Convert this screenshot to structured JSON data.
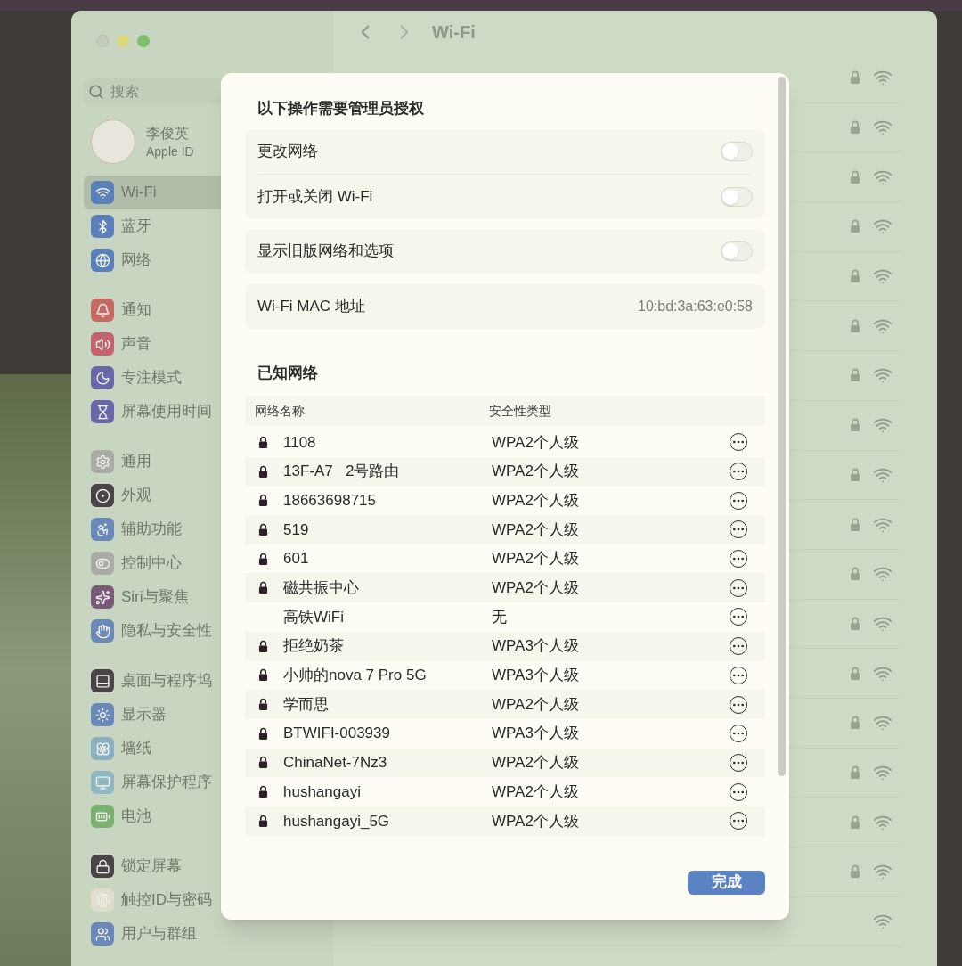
{
  "window": {
    "title": "Wi-Fi"
  },
  "sidebar": {
    "search": {
      "placeholder": "搜索"
    },
    "account": {
      "name": "李俊英",
      "subtitle": "Apple ID"
    },
    "groups": [
      [
        {
          "label": "Wi-Fi",
          "selected": true,
          "color": "#5b7fb8"
        },
        {
          "label": "蓝牙",
          "selected": false,
          "color": "#5b7fb8"
        },
        {
          "label": "网络",
          "selected": false,
          "color": "#5b7fb8"
        }
      ],
      [
        {
          "label": "通知",
          "selected": false,
          "color": "#c46a62"
        },
        {
          "label": "声音",
          "selected": false,
          "color": "#c4626e"
        },
        {
          "label": "专注模式",
          "selected": false,
          "color": "#6a67a8"
        },
        {
          "label": "屏幕使用时间",
          "selected": false,
          "color": "#6a67a8"
        }
      ],
      [
        {
          "label": "通用",
          "selected": false,
          "color": "#a8aca4"
        },
        {
          "label": "外观",
          "selected": false,
          "color": "#4a4448"
        },
        {
          "label": "辅助功能",
          "selected": false,
          "color": "#6a88b8"
        },
        {
          "label": "控制中心",
          "selected": false,
          "color": "#a8aca4"
        },
        {
          "label": "Siri与聚焦",
          "selected": false,
          "color": "#7a5a78"
        },
        {
          "label": "隐私与安全性",
          "selected": false,
          "color": "#6a88b8"
        }
      ],
      [
        {
          "label": "桌面与程序坞",
          "selected": false,
          "color": "#4a4448"
        },
        {
          "label": "显示器",
          "selected": false,
          "color": "#6a88b8"
        },
        {
          "label": "墙纸",
          "selected": false,
          "color": "#8ab0c0"
        },
        {
          "label": "屏幕保护程序",
          "selected": false,
          "color": "#90b8c0"
        },
        {
          "label": "电池",
          "selected": false,
          "color": "#7ab070"
        }
      ],
      [
        {
          "label": "锁定屏幕",
          "selected": false,
          "color": "#4a4448"
        },
        {
          "label": "触控ID与密码",
          "selected": false,
          "color": "#e0dcd0"
        },
        {
          "label": "用户与群组",
          "selected": false,
          "color": "#6a88b8"
        }
      ]
    ]
  },
  "background_networks": [
    {
      "locked": true
    },
    {
      "locked": true
    },
    {
      "locked": true
    },
    {
      "locked": true
    },
    {
      "locked": true
    },
    {
      "locked": true
    },
    {
      "locked": true
    },
    {
      "locked": true
    },
    {
      "locked": true
    },
    {
      "locked": true
    },
    {
      "locked": true
    },
    {
      "locked": true
    },
    {
      "locked": true
    },
    {
      "locked": true
    },
    {
      "locked": true
    },
    {
      "locked": true
    },
    {
      "locked": true
    },
    {
      "locked": false
    }
  ],
  "dialog": {
    "title": "以下操作需要管理员授权",
    "settings": [
      [
        {
          "label": "更改网络",
          "on": false
        },
        {
          "label": "打开或关闭 Wi-Fi",
          "on": false
        }
      ],
      [
        {
          "label": "显示旧版网络和选项",
          "on": false
        }
      ]
    ],
    "mac": {
      "label": "Wi-Fi MAC 地址",
      "value": "10:bd:3a:63:e0:58"
    },
    "known_title": "已知网络",
    "columns": [
      "网络名称",
      "安全性类型"
    ],
    "networks": [
      {
        "name": "1108",
        "security": "WPA2个人级",
        "locked": true
      },
      {
        "name": "13F-A7   2号路由",
        "security": "WPA2个人级",
        "locked": true
      },
      {
        "name": "18663698715",
        "security": "WPA2个人级",
        "locked": true
      },
      {
        "name": "519",
        "security": "WPA2个人级",
        "locked": true
      },
      {
        "name": "601",
        "security": "WPA2个人级",
        "locked": true
      },
      {
        "name": "磁共振中心",
        "security": "WPA2个人级",
        "locked": true
      },
      {
        "name": "高铁WiFi",
        "security": "无",
        "locked": false
      },
      {
        "name": "拒绝奶茶",
        "security": "WPA3个人级",
        "locked": true
      },
      {
        "name": "小帅的nova 7 Pro 5G",
        "security": "WPA3个人级",
        "locked": true
      },
      {
        "name": "学而思",
        "security": "WPA2个人级",
        "locked": true
      },
      {
        "name": "BTWIFI-003939",
        "security": "WPA3个人级",
        "locked": true
      },
      {
        "name": "ChinaNet-7Nz3",
        "security": "WPA2个人级",
        "locked": true
      },
      {
        "name": "hushangayi",
        "security": "WPA2个人级",
        "locked": true
      },
      {
        "name": "hushangayi_5G",
        "security": "WPA2个人级",
        "locked": true
      }
    ],
    "done_button": "完成"
  }
}
